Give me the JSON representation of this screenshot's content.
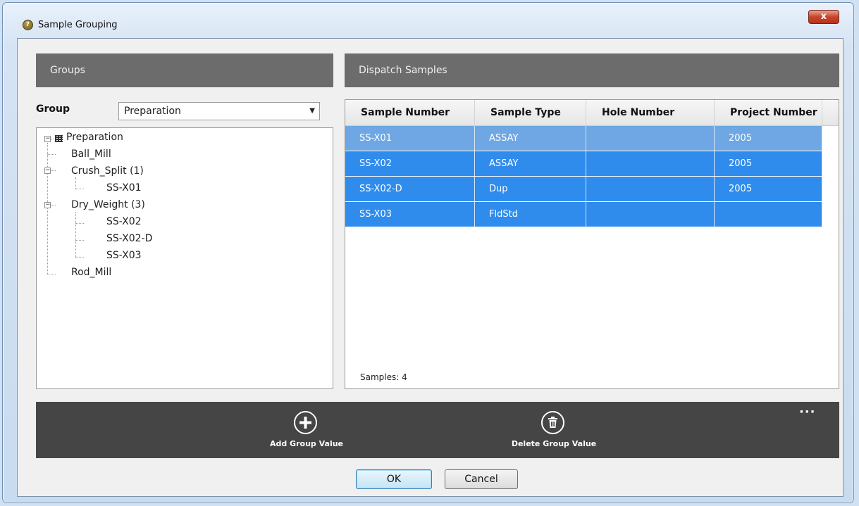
{
  "window": {
    "title": "Sample Grouping",
    "close_label": "x",
    "app_icon": "?"
  },
  "groups_panel": {
    "header": "Groups",
    "group_label": "Group",
    "group_select": {
      "value": "Preparation",
      "arrow": "▼"
    },
    "tree": {
      "root": "Preparation",
      "items": [
        "Ball_Mill",
        "Crush_Split (1)",
        "SS-X01",
        "Dry_Weight (3)",
        "SS-X02",
        "SS-X02-D",
        "SS-X03",
        "Rod_Mill"
      ],
      "expander_minus": "−"
    }
  },
  "dispatch_panel": {
    "header": "Dispatch Samples",
    "columns": [
      "Sample Number",
      "Sample Type",
      "Hole Number",
      "Project Number"
    ],
    "rows": [
      [
        "SS-X01",
        "ASSAY",
        "",
        "2005"
      ],
      [
        "SS-X02",
        "ASSAY",
        "",
        "2005"
      ],
      [
        "SS-X02-D",
        "Dup",
        "",
        "2005"
      ],
      [
        "SS-X03",
        "FldStd",
        "",
        ""
      ]
    ],
    "sample_count": "Samples: 4"
  },
  "toolbar": {
    "add_label": "Add Group Value",
    "delete_label": "Delete Group Value",
    "more_label": "···",
    "icons": {
      "add": "plus-circle-icon",
      "delete": "trash-circle-icon",
      "more": "ellipsis-icon"
    }
  },
  "buttons": {
    "ok": "OK",
    "cancel": "Cancel"
  },
  "colors": {
    "selected_row": "#2f8cec",
    "selected_row_light": "#6ea7e3",
    "header_bg": "#6c6c6c",
    "toolbar_bg": "#454545"
  }
}
